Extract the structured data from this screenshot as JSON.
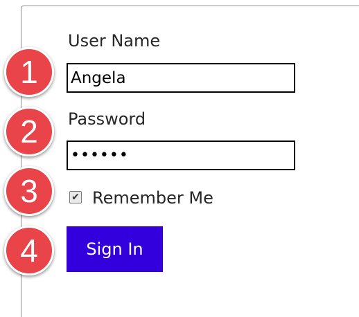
{
  "form": {
    "username_label": "User Name",
    "username_value": "Angela",
    "password_label": "Password",
    "password_value": "••••••",
    "remember_label": "Remember Me",
    "remember_checked": true,
    "checkmark": "✔",
    "sign_in_label": "Sign In"
  },
  "badges": [
    "1",
    "2",
    "3",
    "4"
  ],
  "colors": {
    "badge": "#e8444a",
    "button": "#3300dd"
  }
}
